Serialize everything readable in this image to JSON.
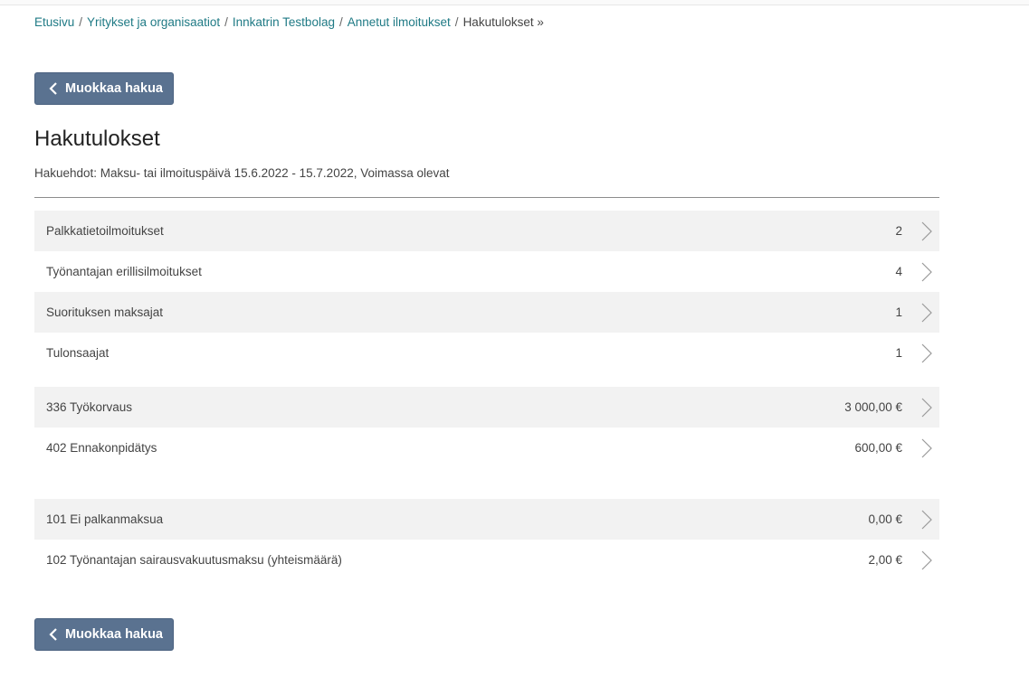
{
  "breadcrumb": {
    "items": [
      "Etusivu",
      "Yritykset ja organisaatiot",
      "Innkatrin Testbolag",
      "Annetut ilmoitukset"
    ],
    "current": "Hakutulokset »"
  },
  "edit_button_label": "Muokkaa hakua",
  "page_title": "Hakutulokset",
  "search_criteria": "Hakuehdot: Maksu- tai ilmoituspäivä 15.6.2022 - 15.7.2022, Voimassa olevat",
  "groups": [
    {
      "rows": [
        {
          "label": "Palkkatietoilmoitukset",
          "value": "2"
        },
        {
          "label": "Työnantajan erillisilmoitukset",
          "value": "4"
        },
        {
          "label": "Suorituksen maksajat",
          "value": "1"
        },
        {
          "label": "Tulonsaajat",
          "value": "1"
        }
      ]
    },
    {
      "rows": [
        {
          "label": "336 Työkorvaus",
          "value": "3 000,00 €"
        },
        {
          "label": "402 Ennakonpidätys",
          "value": "600,00 €"
        }
      ]
    },
    {
      "rows": [
        {
          "label": "101 Ei palkanmaksua",
          "value": "0,00 €"
        },
        {
          "label": "102 Työnantajan sairausvakuutusmaksu (yhteismäärä)",
          "value": "2,00 €"
        }
      ]
    }
  ],
  "icons": {
    "row_arrow": "chevron-right-icon",
    "button": "chevron-left-icon"
  },
  "colors": {
    "link": "#1f7a85",
    "button": "#5a7290",
    "row_alt": "#f2f2f2"
  }
}
